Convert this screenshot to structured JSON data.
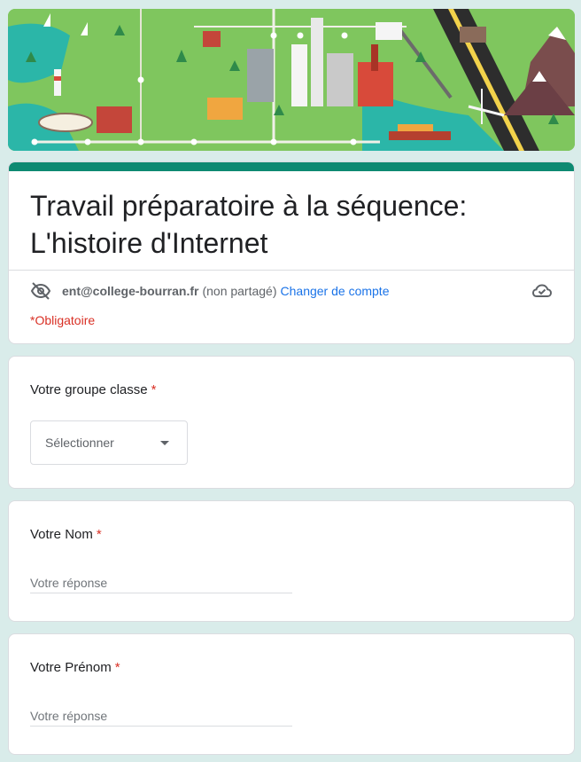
{
  "form": {
    "title_line1": "Travail préparatoire à la séquence:",
    "title_line2": "L'histoire d'Internet",
    "account_email": "ent@college-bourran.fr",
    "account_shared": "(non partagé)",
    "switch_account": "Changer de compte",
    "required_note": "*Obligatoire",
    "accent_color": "#0e8a72"
  },
  "questions": [
    {
      "label": "Votre groupe classe",
      "required_mark": "*",
      "select_placeholder": "Sélectionner"
    },
    {
      "label": "Votre Nom",
      "required_mark": "*",
      "placeholder": "Votre réponse"
    },
    {
      "label": "Votre Prénom",
      "required_mark": "*",
      "placeholder": "Votre réponse"
    }
  ],
  "icons": {
    "visibility": "eye-off-icon",
    "cloud": "cloud-done-icon",
    "dropdown": "caret-down-icon"
  }
}
